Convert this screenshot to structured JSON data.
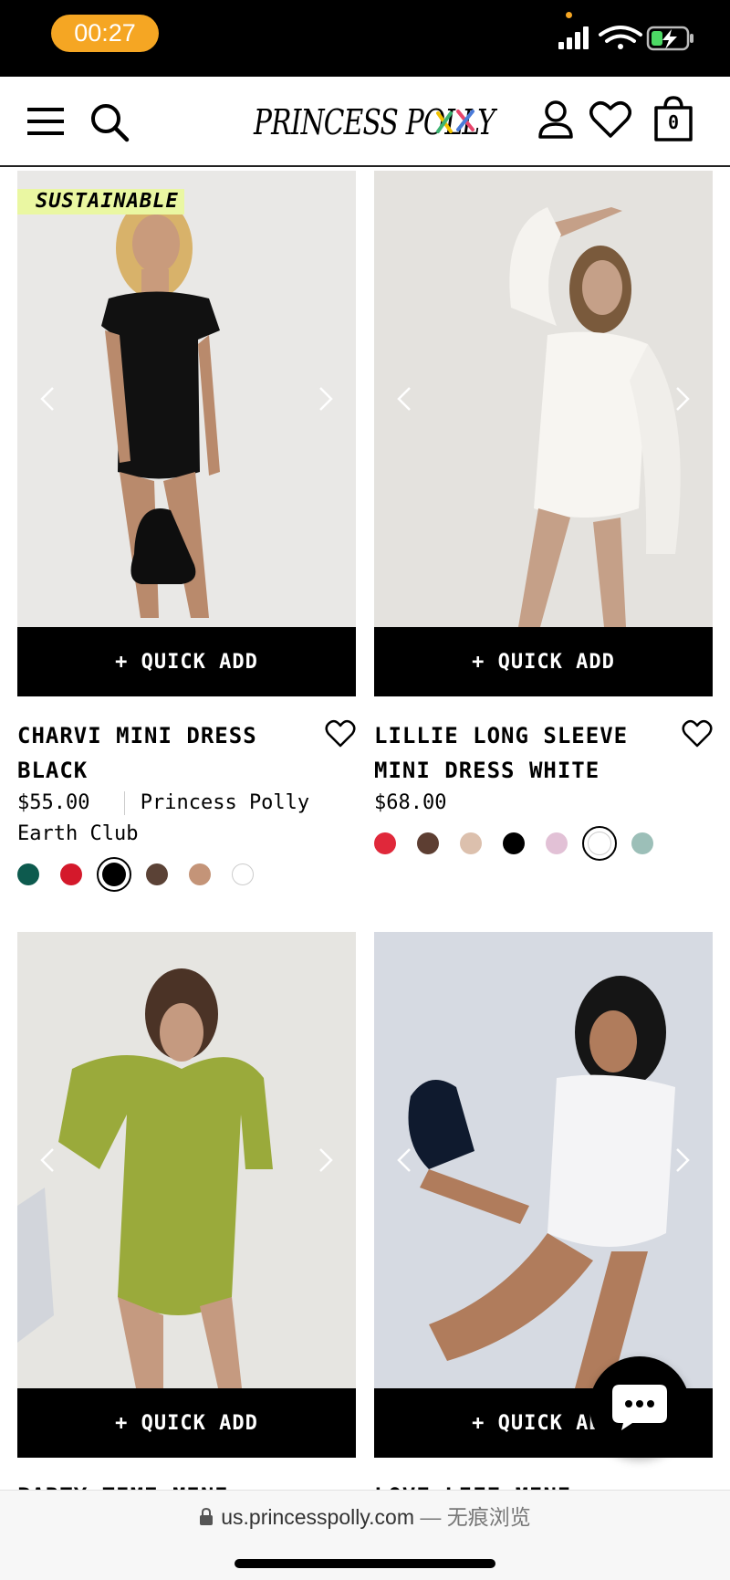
{
  "status_bar": {
    "time": "00:27"
  },
  "header": {
    "logo": "PRINCESS POLLY",
    "cart_count": "0"
  },
  "products": [
    {
      "name": "CHARVI MINI DRESS BLACK",
      "price": "$55.00",
      "brand_label": "Princess Polly Earth Club",
      "badge": "SUSTAINABLE",
      "quick_add": "+ QUICK ADD",
      "swatches": [
        "#0d5a4e",
        "#d4192b",
        "#000000",
        "#5b4236",
        "#c49478",
        "#ffffff"
      ],
      "selected_swatch": 2
    },
    {
      "name": "LILLIE LONG SLEEVE MINI DRESS WHITE",
      "price": "$68.00",
      "quick_add": "+ QUICK ADD",
      "swatches": [
        "#e0283a",
        "#5d3e32",
        "#dcc0ad",
        "#000000",
        "#e2c1d6",
        "#ffffff",
        "#9cbfb8"
      ],
      "selected_swatch": 5
    },
    {
      "name": "PARTY TIME MINI",
      "quick_add": "+ QUICK ADD"
    },
    {
      "name": "LOVE LIFE MINI DRESS",
      "quick_add": "+ QUICK ADD"
    }
  ],
  "url_bar": {
    "domain": "us.princesspolly.com",
    "private_label": "— 无痕浏览"
  }
}
